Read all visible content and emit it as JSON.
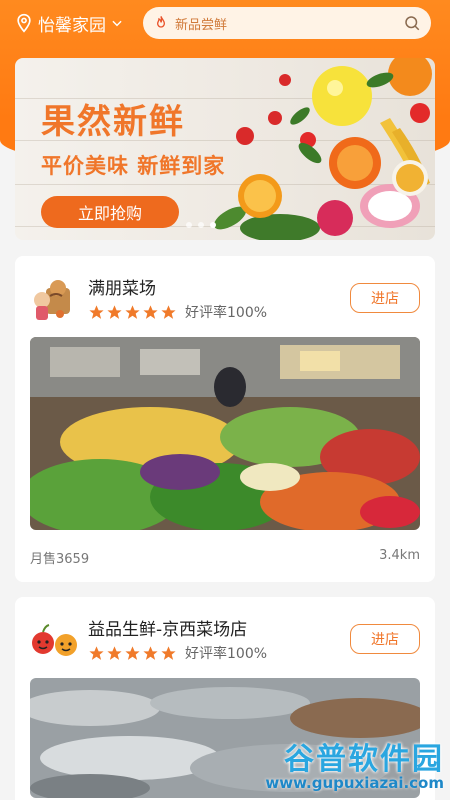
{
  "header": {
    "location": "怡馨家园",
    "search_placeholder": "新品尝鲜"
  },
  "banner": {
    "title": "果然新鲜",
    "subtitle": "平价美味 新鲜到家",
    "cta": "立即抢购",
    "page_count": 3,
    "active_index": 2
  },
  "shops": [
    {
      "name": "满朋菜场",
      "rating_label": "好评率100%",
      "stars": 5,
      "enter_label": "进店",
      "sales": "月售3659",
      "distance": "3.4km"
    },
    {
      "name": "益品生鲜-京西菜场店",
      "rating_label": "好评率100%",
      "stars": 5,
      "enter_label": "进店"
    }
  ],
  "watermark": {
    "title": "谷普软件园",
    "url": "www.gupuxiazai.com"
  },
  "colors": {
    "brand_orange": "#ff7a12",
    "text_orange": "#f0762a",
    "star": "#f07a2a"
  }
}
